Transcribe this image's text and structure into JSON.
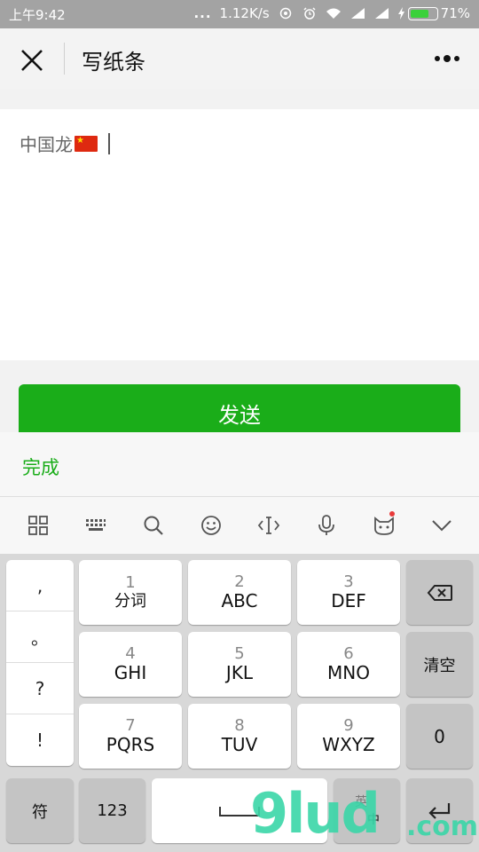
{
  "status_bar": {
    "time": "上午9:42",
    "dots": "...",
    "net_speed": "1.12K/s",
    "battery": "71%",
    "battery_level": 0.71
  },
  "header": {
    "title": "写纸条"
  },
  "editor": {
    "text": "中国龙"
  },
  "send_label": "发送",
  "done_label": "完成",
  "keyboard": {
    "punct": [
      ",",
      "。",
      "?",
      "!"
    ],
    "rows": [
      [
        {
          "num": "1",
          "letters": "分词"
        },
        {
          "num": "2",
          "letters": "ABC"
        },
        {
          "num": "3",
          "letters": "DEF"
        }
      ],
      [
        {
          "num": "4",
          "letters": "GHI"
        },
        {
          "num": "5",
          "letters": "JKL"
        },
        {
          "num": "6",
          "letters": "MNO"
        }
      ],
      [
        {
          "num": "7",
          "letters": "PQRS"
        },
        {
          "num": "8",
          "letters": "TUV"
        },
        {
          "num": "9",
          "letters": "WXYZ"
        }
      ]
    ],
    "clear": "清空",
    "zero": "0",
    "symbol": "符",
    "num_mode": "123",
    "lang_en": "英",
    "lang_zh": "中"
  },
  "watermark": {
    "brand": "9lud",
    "tld": ".com"
  },
  "colors": {
    "accent": "#1aad19",
    "status_bar": "#a3a3a3"
  }
}
